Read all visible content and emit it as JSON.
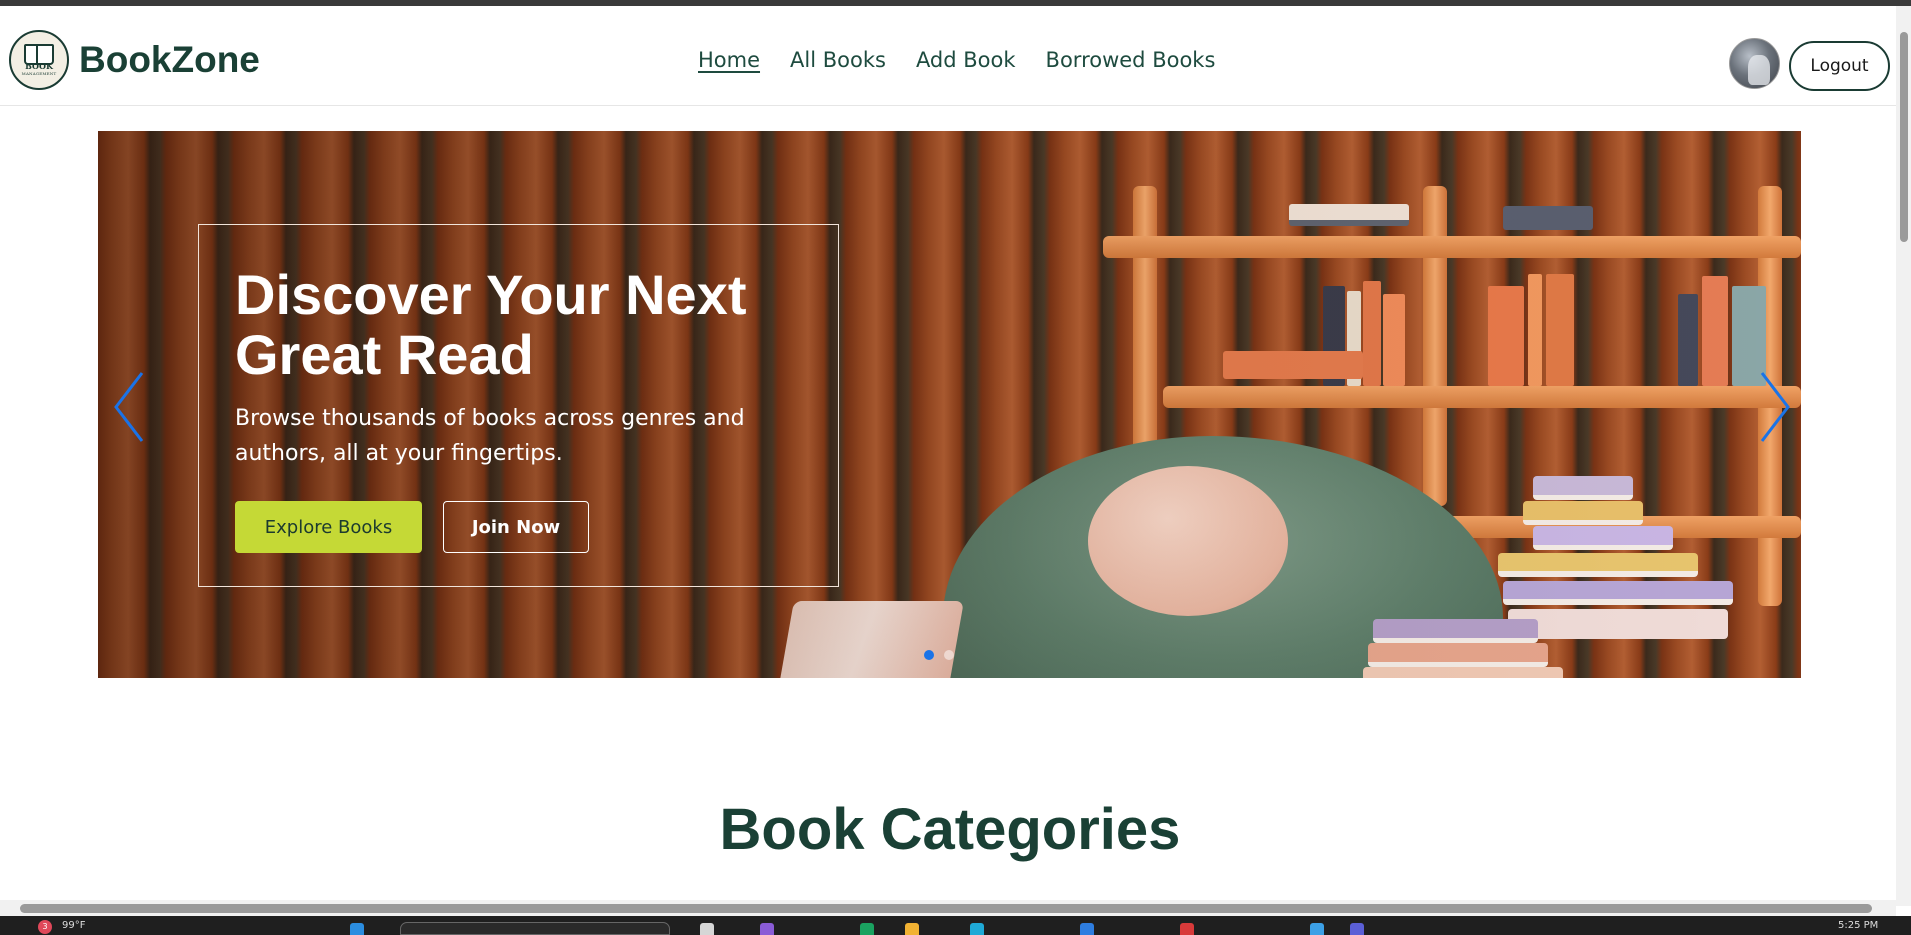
{
  "app": {
    "brand_name": "BookZone",
    "logo_text": "BOOK",
    "logo_sub": "MANAGEMENT"
  },
  "nav": {
    "links": [
      {
        "label": "Home",
        "active": true
      },
      {
        "label": "All Books",
        "active": false
      },
      {
        "label": "Add Book",
        "active": false
      },
      {
        "label": "Borrowed Books",
        "active": false
      }
    ],
    "logout_label": "Logout"
  },
  "hero": {
    "title": "Discover Your Next Great Read",
    "subtitle": "Browse thousands of books across genres and authors, all at your fingertips.",
    "primary_button": "Explore Books",
    "secondary_button": "Join Now",
    "slide_count": 3,
    "active_slide": 1,
    "prev_icon": "chevron-left-icon",
    "next_icon": "chevron-right-icon"
  },
  "sections": {
    "categories_title": "Book Categories"
  },
  "taskbar": {
    "weather": "99°F",
    "time": "5:25 PM",
    "notification_count": "3"
  },
  "colors": {
    "brand_green": "#1a4035",
    "accent_lime": "#c5d936",
    "carousel_indicator": "#1a73e8"
  }
}
